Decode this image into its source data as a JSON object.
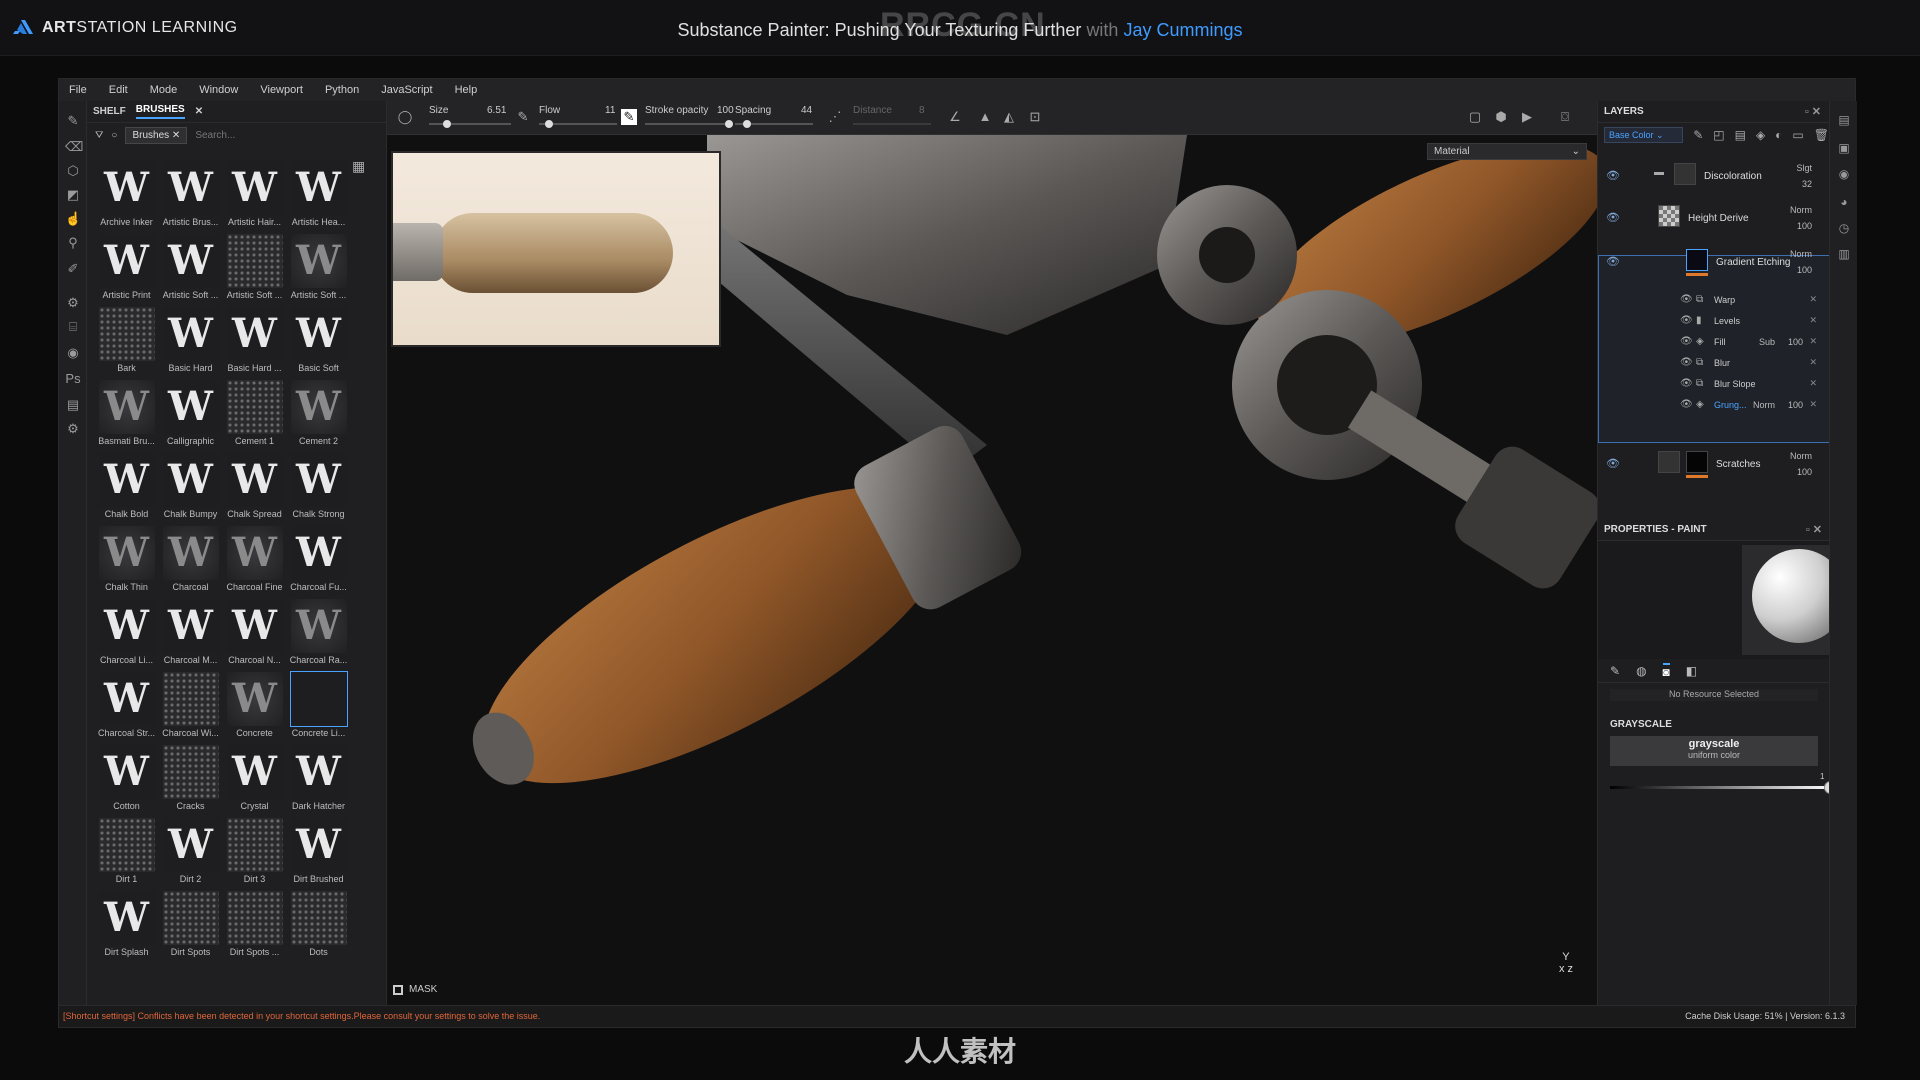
{
  "header": {
    "brand_prefix": "ART",
    "brand_rest": "STATION LEARNING",
    "watermark": "RRCG.CN",
    "title": "Substance Painter: Pushing Your Texturing Further",
    "with": "with",
    "author": "Jay Cummings"
  },
  "menu": [
    "File",
    "Edit",
    "Mode",
    "Window",
    "Viewport",
    "Python",
    "JavaScript",
    "Help"
  ],
  "shelf": {
    "tab_shelf": "SHELF",
    "tab_brushes": "BRUSHES",
    "filter_chip": "Brushes",
    "search_placeholder": "Search...",
    "items": [
      {
        "label": "Archive Inker",
        "style": "white"
      },
      {
        "label": "Artistic Brus...",
        "style": "white"
      },
      {
        "label": "Artistic Hair...",
        "style": "white"
      },
      {
        "label": "Artistic Hea...",
        "style": "white"
      },
      {
        "label": "Artistic Print",
        "style": "white"
      },
      {
        "label": "Artistic Soft ...",
        "style": "white"
      },
      {
        "label": "Artistic Soft ...",
        "style": "grain"
      },
      {
        "label": "Artistic Soft ...",
        "style": "soft"
      },
      {
        "label": "Bark",
        "style": "grain"
      },
      {
        "label": "Basic Hard",
        "style": "white"
      },
      {
        "label": "Basic Hard ...",
        "style": "white"
      },
      {
        "label": "Basic Soft",
        "style": "white"
      },
      {
        "label": "Basmati Bru...",
        "style": "soft"
      },
      {
        "label": "Calligraphic",
        "style": "white"
      },
      {
        "label": "Cement 1",
        "style": "grain"
      },
      {
        "label": "Cement 2",
        "style": "soft"
      },
      {
        "label": "Chalk Bold",
        "style": "white"
      },
      {
        "label": "Chalk Bumpy",
        "style": "white"
      },
      {
        "label": "Chalk Spread",
        "style": "white"
      },
      {
        "label": "Chalk Strong",
        "style": "white"
      },
      {
        "label": "Chalk Thin",
        "style": "soft"
      },
      {
        "label": "Charcoal",
        "style": "soft"
      },
      {
        "label": "Charcoal Fine",
        "style": "soft"
      },
      {
        "label": "Charcoal Fu...",
        "style": "white"
      },
      {
        "label": "Charcoal Li...",
        "style": "white"
      },
      {
        "label": "Charcoal M...",
        "style": "white"
      },
      {
        "label": "Charcoal N...",
        "style": "white"
      },
      {
        "label": "Charcoal Ra...",
        "style": "soft"
      },
      {
        "label": "Charcoal Str...",
        "style": "white"
      },
      {
        "label": "Charcoal Wi...",
        "style": "grain"
      },
      {
        "label": "Concrete",
        "style": "soft"
      },
      {
        "label": "Concrete Li...",
        "style": "selected"
      },
      {
        "label": "Cotton",
        "style": "white"
      },
      {
        "label": "Cracks",
        "style": "grain"
      },
      {
        "label": "Crystal",
        "style": "white"
      },
      {
        "label": "Dark Hatcher",
        "style": "white"
      },
      {
        "label": "Dirt 1",
        "style": "grain"
      },
      {
        "label": "Dirt 2",
        "style": "white"
      },
      {
        "label": "Dirt 3",
        "style": "grain"
      },
      {
        "label": "Dirt Brushed",
        "style": "white"
      },
      {
        "label": "Dirt Splash",
        "style": "white"
      },
      {
        "label": "Dirt Spots",
        "style": "grain"
      },
      {
        "label": "Dirt Spots ...",
        "style": "grain"
      },
      {
        "label": "Dots",
        "style": "grain"
      }
    ]
  },
  "toolbar": {
    "size_label": "Size",
    "size_value": "6.51",
    "flow_label": "Flow",
    "flow_value": "11",
    "opacity_label": "Stroke opacity",
    "opacity_value": "100",
    "spacing_label": "Spacing",
    "spacing_value": "44",
    "distance_label": "Distance",
    "distance_value": "8"
  },
  "viewport": {
    "material_select": "Material",
    "mask_label": "MASK",
    "axis_y": "Y",
    "axis_xz": "x   z"
  },
  "layers": {
    "title": "LAYERS",
    "channel": "Base Color",
    "items": [
      {
        "name": "Discoloration",
        "blend": "Slgt",
        "opacity": "32"
      },
      {
        "name": "Height Derive",
        "blend": "Norm",
        "opacity": "100"
      },
      {
        "name": "Gradient Etching",
        "blend": "Norm",
        "opacity": "100"
      },
      {
        "name": "Scratches",
        "blend": "Norm",
        "opacity": "100"
      }
    ],
    "effects": [
      {
        "name": "Warp",
        "blend": "",
        "opacity": ""
      },
      {
        "name": "Levels",
        "blend": "",
        "opacity": ""
      },
      {
        "name": "Fill",
        "blend": "Sub",
        "opacity": "100"
      },
      {
        "name": "Blur",
        "blend": "",
        "opacity": ""
      },
      {
        "name": "Blur Slope",
        "blend": "",
        "opacity": ""
      },
      {
        "name": "Grung...",
        "blend": "Norm",
        "opacity": "100"
      }
    ]
  },
  "properties": {
    "title": "PROPERTIES - PAINT",
    "resource": "No Resource Selected",
    "section": "GRAYSCALE",
    "gs_title": "grayscale",
    "gs_sub": "uniform color",
    "gs_value": "1"
  },
  "status": {
    "warning": "[Shortcut settings] Conflicts have been detected in your shortcut settings.Please consult your settings to solve the issue.",
    "right": "Cache Disk Usage:   51% | Version: 6.1.3"
  },
  "bottom_watermark": "人人素材",
  "colors": {
    "accent": "#4aa3ff",
    "warning": "#e0663a"
  }
}
